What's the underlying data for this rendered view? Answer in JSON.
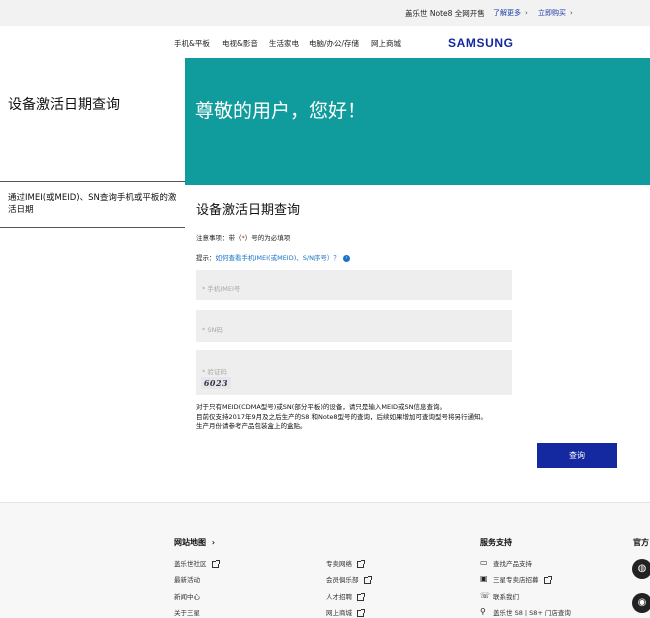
{
  "promo": {
    "text": "盖乐世 Note8 全网开售",
    "learn_more": "了解更多",
    "buy_now": "立即购买",
    "chevron": "›"
  },
  "nav": {
    "items": [
      "手机&平板",
      "电视&影音",
      "生活家电",
      "电脑/办公/存储",
      "网上商城"
    ],
    "logo": "SAMSUNG"
  },
  "left_panel": {
    "title": "设备激活日期查询",
    "subtitle": "通过IMEI(或MEID)、SN查询手机或平板的激活日期"
  },
  "hero": {
    "greeting": "尊敬的用户，您好！",
    "color": "#109c9c"
  },
  "form": {
    "title": "设备激活日期查询",
    "note_prefix": "注意事项：带（",
    "note_star": "*",
    "note_suffix": "）号的为必填项",
    "hint_prefix": "提示：",
    "hint_link": "如何查看手机IMEI(或MEID)、S/N序号）？",
    "hint_icon": "›",
    "imei_placeholder": "* 手机IMEI号",
    "sn_placeholder": "* SN码",
    "captcha_placeholder": "* 验证码",
    "captcha_value": "6023",
    "info_lines": [
      "对于只有MEID(CDMA型号)或SN(部分平板)的设备，请只是输入MEID或SN信息查询。",
      "目前仅支持2017年9月及之后生产的S8 和Note8型号的查询，后续如果增加可查询型号将另行通知。",
      "生产月份请参考产品包装盒上的盒贴。"
    ],
    "submit_label": "查询",
    "accent": "#1428a0"
  },
  "footer": {
    "sitemap_title": "网站地图",
    "sitemap_chevron": "›",
    "col1": [
      "盖乐世社区",
      "最新活动",
      "新闻中心",
      "关于三星"
    ],
    "col2": [
      "专卖网络",
      "会员俱乐部",
      "人才招聘",
      "网上商城"
    ],
    "support_title": "服务支持",
    "support": [
      "查找产品支持",
      "三星专卖店招募",
      "联系我们",
      "盖乐世 S8 | S8+ 门店查询"
    ],
    "official_title": "官方"
  }
}
